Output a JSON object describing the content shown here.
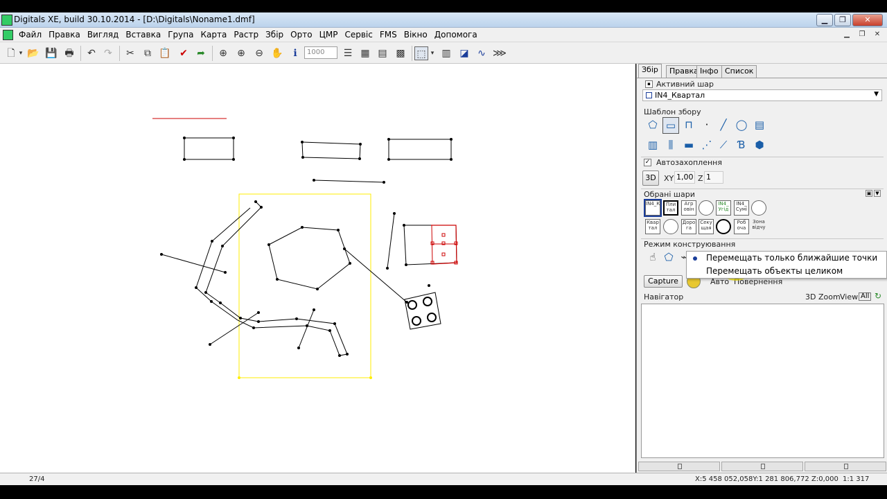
{
  "window": {
    "title": "Digitals XE, build 30.10.2014 - [D:\\Digitals\\Noname1.dmf]"
  },
  "menu": [
    "Файл",
    "Правка",
    "Вигляд",
    "Вставка",
    "Група",
    "Карта",
    "Растр",
    "Збір",
    "Орто",
    "ЦМР",
    "Сервіс",
    "FMS",
    "Вікно",
    "Допомога"
  ],
  "toolbar": {
    "scale_value": "1000"
  },
  "panel": {
    "tabs": [
      "Збір",
      "Правка",
      "Інфо",
      "Список"
    ],
    "active_layer_label": "Активний шар",
    "active_layer_value": "IN4_Квартал",
    "template_label": "Шаблон збору",
    "autocapture_label": "Автозахоплення",
    "btn_3d": "3D",
    "xy_label": "XY",
    "xy_value": "1,00",
    "z_label": "Z",
    "z_value": "1",
    "selected_layers_label": "Обрані шари",
    "layers_row1": [
      "IN4_Ква",
      "Пли тал",
      "Агр овін",
      "",
      "IN4_ Угід",
      "IN4_ Сумі",
      ""
    ],
    "layers_row2": [
      "Квар тал",
      "",
      "Доро га",
      "Секу щая",
      "",
      "Роб оча",
      "Зона відчу"
    ],
    "mode_label": "Режим конструювання",
    "capture_btn": "Capture",
    "auto_label": "Авто",
    "rotate_label": "Повернення",
    "navigator_label": "Навігатор",
    "nav_3d": "3D",
    "nav_zoom": "Zoom",
    "nav_view": "View",
    "nav_all": "All"
  },
  "popup": {
    "option1": "Перемещать только ближайшие точки",
    "option2": "Перемещать объекты целиком"
  },
  "status": {
    "left": "27/4",
    "coords": "X:5 458 052,058Y:1 281 806,772",
    "z": "Z:0,000",
    "scale": "1:1 317"
  },
  "colors": {
    "selection_frame": "#ffee00",
    "selected_object": "#cc0000",
    "line": "#000000"
  }
}
